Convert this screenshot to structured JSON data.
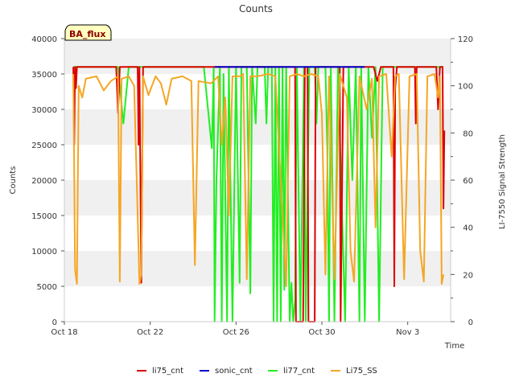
{
  "chart_data": {
    "type": "line",
    "title": "Counts",
    "badge": "BA_flux",
    "xlabel": "Time",
    "ylabel": "Counts",
    "y2label": "LI-7550 Signal Strength",
    "x_range": [
      "2023-10-18",
      "2023-11-05"
    ],
    "x_ticks": [
      {
        "date": "2023-10-18",
        "label": "Oct 18"
      },
      {
        "date": "2023-10-22",
        "label": "Oct 22"
      },
      {
        "date": "2023-10-26",
        "label": "Oct 26"
      },
      {
        "date": "2023-10-30",
        "label": "Oct 30"
      },
      {
        "date": "2023-11-03",
        "label": "Nov 3"
      }
    ],
    "ylim": [
      0,
      40000
    ],
    "y_ticks": [
      0,
      5000,
      10000,
      15000,
      20000,
      25000,
      30000,
      35000,
      40000
    ],
    "y2lim": [
      0,
      120
    ],
    "y2_ticks": [
      0,
      20,
      40,
      60,
      80,
      100,
      120
    ],
    "grid": "horizontal bands",
    "legend_position": "bottom",
    "colors": {
      "li75_cnt": "#dd0000",
      "sonic_cnt": "#0000cc",
      "li77_cnt": "#22ee22",
      "Li75_SS": "#f5a623",
      "band": "#f0f0f0",
      "badge_fill": "#ffffc0"
    },
    "series": [
      {
        "name": "li75_cnt",
        "axis": "left",
        "points": [
          [
            "2023-10-18T10:00",
            36000
          ],
          [
            "2023-10-18T11:00",
            25000
          ],
          [
            "2023-10-18T12:00",
            36000
          ],
          [
            "2023-10-18T13:00",
            33000
          ],
          [
            "2023-10-18T14:00",
            36000
          ],
          [
            "2023-10-20T10:00",
            36000
          ],
          [
            "2023-10-20T12:00",
            29500
          ],
          [
            "2023-10-20T14:00",
            36000
          ],
          [
            "2023-10-21T10:00",
            36000
          ],
          [
            "2023-10-21T11:00",
            25000
          ],
          [
            "2023-10-21T12:00",
            36000
          ],
          [
            "2023-10-21T14:00",
            5500
          ],
          [
            "2023-10-21T16:00",
            36000
          ],
          [
            "2023-10-28T18:00",
            36000
          ],
          [
            "2023-10-28T19:00",
            0
          ],
          [
            "2023-10-29T03:00",
            0
          ],
          [
            "2023-10-29T05:00",
            36000
          ],
          [
            "2023-10-29T08:00",
            36000
          ],
          [
            "2023-10-29T09:00",
            0
          ],
          [
            "2023-10-29T16:00",
            0
          ],
          [
            "2023-10-29T17:00",
            36000
          ],
          [
            "2023-10-30T20:00",
            36000
          ],
          [
            "2023-10-30T21:00",
            0
          ],
          [
            "2023-10-31T00:00",
            36000
          ],
          [
            "2023-11-01T10:00",
            36000
          ],
          [
            "2023-11-01T14:00",
            34000
          ],
          [
            "2023-11-01T18:00",
            36000
          ],
          [
            "2023-11-02T08:00",
            36000
          ],
          [
            "2023-11-02T09:00",
            5000
          ],
          [
            "2023-11-02T10:00",
            33000
          ],
          [
            "2023-11-02T12:00",
            36000
          ],
          [
            "2023-11-03T08:00",
            36000
          ],
          [
            "2023-11-03T09:00",
            28000
          ],
          [
            "2023-11-03T10:00",
            36000
          ],
          [
            "2023-11-04T08:00",
            36000
          ],
          [
            "2023-11-04T10:00",
            30000
          ],
          [
            "2023-11-04T12:00",
            36000
          ],
          [
            "2023-11-04T15:00",
            36000
          ],
          [
            "2023-11-04T16:00",
            16000
          ],
          [
            "2023-11-04T17:00",
            27000
          ]
        ]
      },
      {
        "name": "sonic_cnt",
        "axis": "left",
        "points": [
          [
            "2023-10-25T00:00",
            36000
          ],
          [
            "2023-11-01T00:00",
            36000
          ]
        ]
      },
      {
        "name": "li77_cnt",
        "axis": "left",
        "points": [
          [
            "2023-10-18T10:00",
            36000
          ],
          [
            "2023-10-20T12:00",
            36000
          ],
          [
            "2023-10-20T18:00",
            28000
          ],
          [
            "2023-10-21T00:00",
            36000
          ],
          [
            "2023-10-24T12:00",
            36000
          ],
          [
            "2023-10-24T21:00",
            24500
          ],
          [
            "2023-10-24T23:00",
            36000
          ],
          [
            "2023-10-25T00:00",
            0
          ],
          [
            "2023-10-25T02:00",
            19500
          ],
          [
            "2023-10-25T06:00",
            36000
          ],
          [
            "2023-10-25T08:00",
            0
          ],
          [
            "2023-10-25T10:00",
            35000
          ],
          [
            "2023-10-25T14:00",
            0
          ],
          [
            "2023-10-25T16:00",
            36000
          ],
          [
            "2023-10-25T20:00",
            0
          ],
          [
            "2023-10-26T00:00",
            36000
          ],
          [
            "2023-10-26T04:00",
            5500
          ],
          [
            "2023-10-26T06:00",
            36000
          ],
          [
            "2023-10-26T12:00",
            36000
          ],
          [
            "2023-10-26T16:00",
            4000
          ],
          [
            "2023-10-26T18:00",
            36000
          ],
          [
            "2023-10-26T22:00",
            28000
          ],
          [
            "2023-10-27T00:00",
            36000
          ],
          [
            "2023-10-27T08:00",
            36000
          ],
          [
            "2023-10-27T10:00",
            28000
          ],
          [
            "2023-10-27T12:00",
            36000
          ],
          [
            "2023-10-27T16:00",
            36000
          ],
          [
            "2023-10-27T18:00",
            0
          ],
          [
            "2023-10-27T20:00",
            36000
          ],
          [
            "2023-10-27T22:00",
            0
          ],
          [
            "2023-10-28T00:00",
            36000
          ],
          [
            "2023-10-28T02:00",
            0
          ],
          [
            "2023-10-28T04:00",
            36000
          ],
          [
            "2023-10-28T06:00",
            4500
          ],
          [
            "2023-10-28T08:00",
            36000
          ],
          [
            "2023-10-28T12:00",
            0
          ],
          [
            "2023-10-28T14:00",
            5500
          ],
          [
            "2023-10-28T16:00",
            0
          ],
          [
            "2023-10-28T18:00",
            3000
          ],
          [
            "2023-10-28T20:00",
            36000
          ],
          [
            "2023-10-29T00:00",
            0
          ],
          [
            "2023-10-29T04:00",
            36000
          ],
          [
            "2023-10-29T06:00",
            0
          ],
          [
            "2023-10-29T10:00",
            36000
          ],
          [
            "2023-10-29T16:00",
            36000
          ],
          [
            "2023-10-29T18:00",
            28000
          ],
          [
            "2023-10-29T20:00",
            36000
          ],
          [
            "2023-10-30T04:00",
            36000
          ],
          [
            "2023-10-30T06:00",
            24500
          ],
          [
            "2023-10-30T08:00",
            0
          ],
          [
            "2023-10-30T10:00",
            36000
          ],
          [
            "2023-10-30T14:00",
            0
          ],
          [
            "2023-10-30T18:00",
            36000
          ],
          [
            "2023-10-31T02:00",
            0
          ],
          [
            "2023-10-31T06:00",
            36000
          ],
          [
            "2023-10-31T10:00",
            20000
          ],
          [
            "2023-10-31T14:00",
            36000
          ],
          [
            "2023-10-31T18:00",
            0
          ],
          [
            "2023-10-31T20:00",
            36000
          ],
          [
            "2023-11-01T00:00",
            0
          ],
          [
            "2023-11-01T04:00",
            36000
          ],
          [
            "2023-11-01T08:00",
            26000
          ],
          [
            "2023-11-01T12:00",
            36000
          ],
          [
            "2023-11-01T16:00",
            0
          ],
          [
            "2023-11-01T20:00",
            36000
          ],
          [
            "2023-11-02T00:00",
            36000
          ],
          [
            "2023-11-04T16:00",
            36000
          ]
        ]
      },
      {
        "name": "Li75_SS",
        "axis": "right",
        "points": [
          [
            "2023-10-18T10:00",
            105
          ],
          [
            "2023-10-18T12:00",
            22
          ],
          [
            "2023-10-18T14:00",
            16
          ],
          [
            "2023-10-18T16:00",
            100
          ],
          [
            "2023-10-18T20:00",
            95
          ],
          [
            "2023-10-19T00:00",
            103
          ],
          [
            "2023-10-19T12:00",
            104
          ],
          [
            "2023-10-19T20:00",
            98
          ],
          [
            "2023-10-20T04:00",
            102
          ],
          [
            "2023-10-20T12:00",
            104
          ],
          [
            "2023-10-20T14:00",
            17
          ],
          [
            "2023-10-20T16:00",
            103
          ],
          [
            "2023-10-21T00:00",
            104
          ],
          [
            "2023-10-21T06:00",
            100
          ],
          [
            "2023-10-21T10:00",
            45
          ],
          [
            "2023-10-21T12:00",
            16
          ],
          [
            "2023-10-21T14:00",
            20
          ],
          [
            "2023-10-21T16:00",
            104
          ],
          [
            "2023-10-21T22:00",
            96
          ],
          [
            "2023-10-22T06:00",
            104
          ],
          [
            "2023-10-22T12:00",
            101
          ],
          [
            "2023-10-22T18:00",
            92
          ],
          [
            "2023-10-23T00:00",
            103
          ],
          [
            "2023-10-23T12:00",
            104
          ],
          [
            "2023-10-23T22:00",
            102
          ],
          [
            "2023-10-24T02:00",
            24
          ],
          [
            "2023-10-24T06:00",
            102
          ],
          [
            "2023-10-24T20:00",
            101
          ],
          [
            "2023-10-25T04:00",
            104
          ],
          [
            "2023-10-25T08:00",
            75
          ],
          [
            "2023-10-25T12:00",
            95
          ],
          [
            "2023-10-25T16:00",
            45
          ],
          [
            "2023-10-25T20:00",
            104
          ],
          [
            "2023-10-26T04:00",
            104
          ],
          [
            "2023-10-26T08:00",
            105
          ],
          [
            "2023-10-26T12:00",
            18
          ],
          [
            "2023-10-26T16:00",
            104
          ],
          [
            "2023-10-27T00:00",
            104
          ],
          [
            "2023-10-27T12:00",
            105
          ],
          [
            "2023-10-27T20:00",
            104
          ],
          [
            "2023-10-28T04:00",
            45
          ],
          [
            "2023-10-28T08:00",
            15
          ],
          [
            "2023-10-28T12:00",
            104
          ],
          [
            "2023-10-28T20:00",
            105
          ],
          [
            "2023-10-29T04:00",
            104
          ],
          [
            "2023-10-29T12:00",
            105
          ],
          [
            "2023-10-29T20:00",
            104
          ],
          [
            "2023-10-30T00:00",
            88
          ],
          [
            "2023-10-30T04:00",
            20
          ],
          [
            "2023-10-30T08:00",
            104
          ],
          [
            "2023-10-30T14:00",
            18
          ],
          [
            "2023-10-30T20:00",
            105
          ],
          [
            "2023-10-31T04:00",
            95
          ],
          [
            "2023-10-31T08:00",
            30
          ],
          [
            "2023-10-31T12:00",
            17
          ],
          [
            "2023-10-31T18:00",
            104
          ],
          [
            "2023-11-01T02:00",
            90
          ],
          [
            "2023-11-01T08:00",
            103
          ],
          [
            "2023-11-01T12:00",
            40
          ],
          [
            "2023-11-01T16:00",
            104
          ],
          [
            "2023-11-02T00:00",
            105
          ],
          [
            "2023-11-02T06:00",
            70
          ],
          [
            "2023-11-02T10:00",
            104
          ],
          [
            "2023-11-02T14:00",
            105
          ],
          [
            "2023-11-02T20:00",
            18
          ],
          [
            "2023-11-03T02:00",
            104
          ],
          [
            "2023-11-03T10:00",
            105
          ],
          [
            "2023-11-03T14:00",
            30
          ],
          [
            "2023-11-03T18:00",
            17
          ],
          [
            "2023-11-03T22:00",
            104
          ],
          [
            "2023-11-04T06:00",
            105
          ],
          [
            "2023-11-04T10:00",
            95
          ],
          [
            "2023-11-04T12:00",
            104
          ],
          [
            "2023-11-04T14:00",
            16
          ],
          [
            "2023-11-04T16:00",
            20
          ]
        ]
      }
    ]
  }
}
